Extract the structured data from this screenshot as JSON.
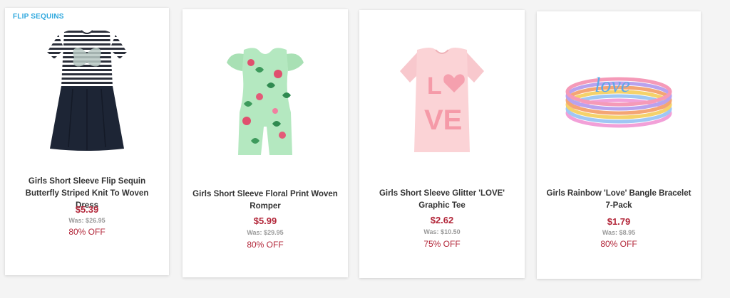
{
  "colors": {
    "badge": "#2fa8de",
    "sale_price": "#b3273a",
    "was_price": "#9a9a9a",
    "name_text": "#333333"
  },
  "products": [
    {
      "badge": "FLIP SEQUINS",
      "image_icon": "striped-dress-icon",
      "name": "Girls Short Sleeve Flip Sequin Butterfly Striped Knit To Woven Dress",
      "price": "$5.39",
      "was": "Was: $26.95",
      "off": "80% OFF"
    },
    {
      "image_icon": "floral-romper-icon",
      "name": "Girls Short Sleeve Floral Print Woven Romper",
      "price": "$5.99",
      "was": "Was: $29.95",
      "off": "80% OFF"
    },
    {
      "image_icon": "love-tee-icon",
      "name": "Girls Short Sleeve Glitter 'LOVE' Graphic Tee",
      "price": "$2.62",
      "was": "Was: $10.50",
      "off": "75% OFF"
    },
    {
      "image_icon": "bangle-bracelets-icon",
      "name": "Girls Rainbow 'Love' Bangle Bracelet 7-Pack",
      "price": "$1.79",
      "was": "Was: $8.95",
      "off": "80% OFF"
    }
  ]
}
